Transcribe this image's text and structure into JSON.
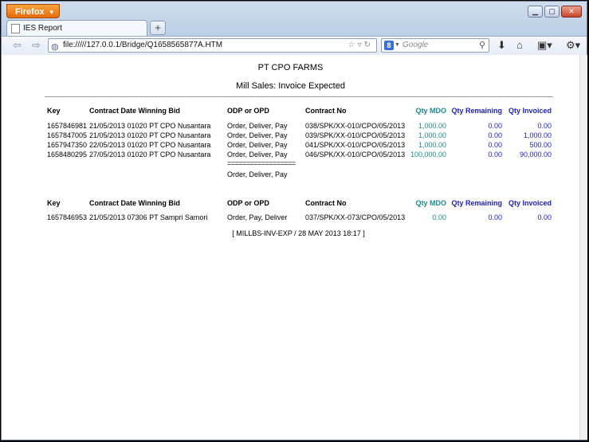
{
  "browser": {
    "app_button": "Firefox",
    "tab_title": "IES Report",
    "url": "file://///127.0.0.1/Bridge/Q1658565877A.HTM",
    "search_placeholder": "Google",
    "search_engine_letter": "8"
  },
  "report": {
    "company": "PT CPO FARMS",
    "title": "Mill Sales: Invoice Expected",
    "headers": {
      "key": "Key",
      "date_bid": "Contract Date Winning Bid",
      "odp": "ODP or OPD",
      "contract": "Contract No",
      "qty_mdo": "Qty MDO",
      "qty_remaining": "Qty Remaining",
      "qty_invoiced": "Qty Invoiced"
    },
    "group1": [
      {
        "key": "1657846981",
        "date_bid": "21/05/2013 01020 PT CPO Nusantara",
        "odp": "Order, Deliver, Pay",
        "contract": "038/SPK/XX-010/CPO/05/2013",
        "mdo": "1,000.00",
        "remaining": "0.00",
        "invoiced": "0.00"
      },
      {
        "key": "1657847005",
        "date_bid": "21/05/2013 01020 PT CPO Nusantara",
        "odp": "Order, Deliver, Pay",
        "contract": "039/SPK/XX-010/CPO/05/2013",
        "mdo": "1,000.00",
        "remaining": "0.00",
        "invoiced": "1,000.00"
      },
      {
        "key": "1657947350",
        "date_bid": "22/05/2013 01020 PT CPO Nusantara",
        "odp": "Order, Deliver, Pay",
        "contract": "041/SPK/XX-010/CPO/05/2013",
        "mdo": "1,000.00",
        "remaining": "0.00",
        "invoiced": "500.00"
      },
      {
        "key": "1658480295",
        "date_bid": "27/05/2013 01020 PT CPO Nusantara",
        "odp": "Order, Deliver, Pay",
        "contract": "046/SPK/XX-010/CPO/05/2013",
        "mdo": "100,000.00",
        "remaining": "0.00",
        "invoiced": "90,000.00"
      }
    ],
    "group1_separator": "==================",
    "group1_summary_odp": "Order, Deliver, Pay",
    "group2": [
      {
        "key": "1657846953",
        "date_bid": "21/05/2013 07306 PT Sampri Samori",
        "odp": "Order, Pay, Deliver",
        "contract": "037/SPK/XX-073/CPO/05/2013",
        "mdo": "0.00",
        "remaining": "0.00",
        "invoiced": "0.00"
      }
    ],
    "footer": "[ MILLBS-INV-EXP / 28 MAY 2013 18:17 ]"
  }
}
